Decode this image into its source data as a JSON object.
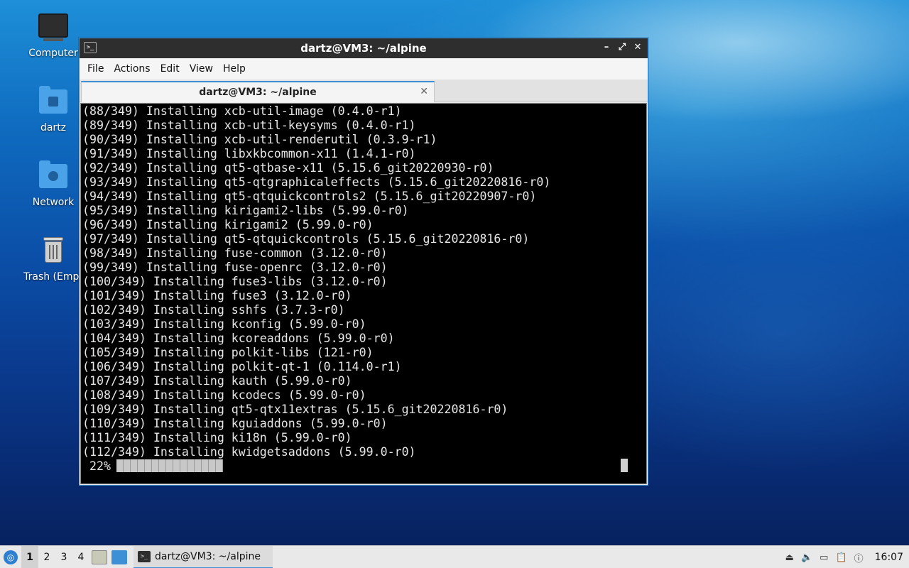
{
  "desktop": {
    "icons": [
      {
        "label": "Computer"
      },
      {
        "label": "dartz"
      },
      {
        "label": "Network"
      },
      {
        "label": "Trash (Empt"
      }
    ]
  },
  "window": {
    "title": "dartz@VM3: ~/alpine",
    "controls": {
      "minimize": "–",
      "maximize": "⤢",
      "close": "✕"
    },
    "menu": [
      "File",
      "Actions",
      "Edit",
      "View",
      "Help"
    ],
    "tab": {
      "label": "dartz@VM3: ~/alpine",
      "close": "✕"
    }
  },
  "terminal": {
    "lines": [
      "(88/349) Installing xcb-util-image (0.4.0-r1)",
      "(89/349) Installing xcb-util-keysyms (0.4.0-r1)",
      "(90/349) Installing xcb-util-renderutil (0.3.9-r1)",
      "(91/349) Installing libxkbcommon-x11 (1.4.1-r0)",
      "(92/349) Installing qt5-qtbase-x11 (5.15.6_git20220930-r0)",
      "(93/349) Installing qt5-qtgraphicaleffects (5.15.6_git20220816-r0)",
      "(94/349) Installing qt5-qtquickcontrols2 (5.15.6_git20220907-r0)",
      "(95/349) Installing kirigami2-libs (5.99.0-r0)",
      "(96/349) Installing kirigami2 (5.99.0-r0)",
      "(97/349) Installing qt5-qtquickcontrols (5.15.6_git20220816-r0)",
      "(98/349) Installing fuse-common (3.12.0-r0)",
      "(99/349) Installing fuse-openrc (3.12.0-r0)",
      "(100/349) Installing fuse3-libs (3.12.0-r0)",
      "(101/349) Installing fuse3 (3.12.0-r0)",
      "(102/349) Installing sshfs (3.7.3-r0)",
      "(103/349) Installing kconfig (5.99.0-r0)",
      "(104/349) Installing kcoreaddons (5.99.0-r0)",
      "(105/349) Installing polkit-libs (121-r0)",
      "(106/349) Installing polkit-qt-1 (0.114.0-r1)",
      "(107/349) Installing kauth (5.99.0-r0)",
      "(108/349) Installing kcodecs (5.99.0-r0)",
      "(109/349) Installing qt5-qtx11extras (5.15.6_git20220816-r0)",
      "(110/349) Installing kguiaddons (5.99.0-r0)",
      "(111/349) Installing ki18n (5.99.0-r0)",
      "(112/349) Installing kwidgetsaddons (5.99.0-r0)"
    ],
    "progress": {
      "label": " 22%",
      "percent": 22
    }
  },
  "taskbar": {
    "workspaces": [
      "1",
      "2",
      "3",
      "4"
    ],
    "active_workspace": "1",
    "task_label": "dartz@VM3: ~/alpine",
    "clock": "16:07"
  }
}
